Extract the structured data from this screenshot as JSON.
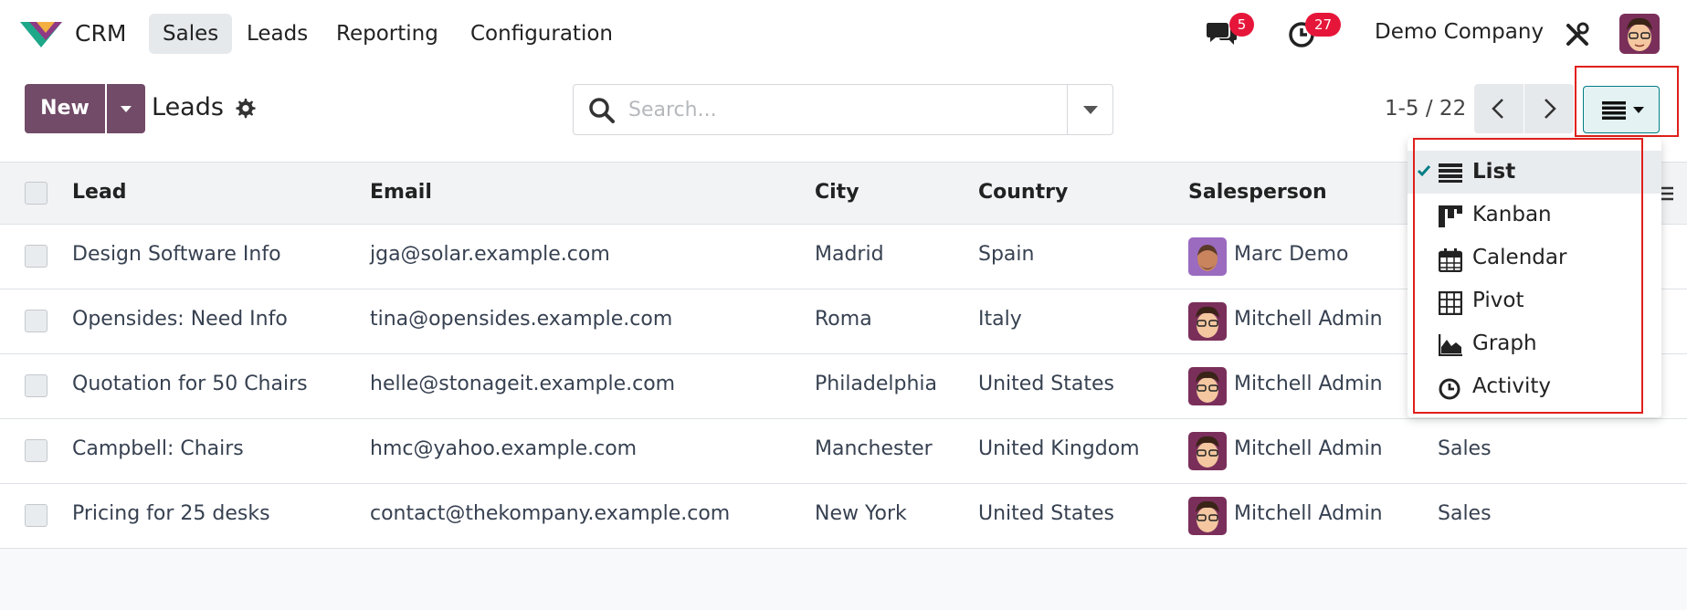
{
  "navbar": {
    "app_name": "CRM",
    "menu": [
      "Sales",
      "Leads",
      "Reporting",
      "Configuration"
    ],
    "active_menu": "Sales",
    "messages_badge": "5",
    "activities_badge": "27",
    "company": "Demo Company"
  },
  "control": {
    "new_label": "New",
    "title": "Leads",
    "search_placeholder": "Search...",
    "pager": "1-5 / 22"
  },
  "table": {
    "headers": [
      "Lead",
      "Email",
      "City",
      "Country",
      "Salesperson"
    ],
    "rows": [
      {
        "lead": "Design Software Info",
        "email": "jga@solar.example.com",
        "city": "Madrid",
        "country": "Spain",
        "salesperson": "Marc Demo",
        "team": ""
      },
      {
        "lead": "Opensides: Need Info",
        "email": "tina@opensides.example.com",
        "city": "Roma",
        "country": "Italy",
        "salesperson": "Mitchell Admin",
        "team": ""
      },
      {
        "lead": "Quotation for 50 Chairs",
        "email": "helle@stonageit.example.com",
        "city": "Philadelphia",
        "country": "United States",
        "salesperson": "Mitchell Admin",
        "team": ""
      },
      {
        "lead": "Campbell: Chairs",
        "email": "hmc@yahoo.example.com",
        "city": "Manchester",
        "country": "United Kingdom",
        "salesperson": "Mitchell Admin",
        "team": "Sales"
      },
      {
        "lead": "Pricing for 25 desks",
        "email": "contact@thekompany.example.com",
        "city": "New York",
        "country": "United States",
        "salesperson": "Mitchell Admin",
        "team": "Sales"
      }
    ]
  },
  "view_menu": {
    "items": [
      "List",
      "Kanban",
      "Calendar",
      "Pivot",
      "Graph",
      "Activity"
    ],
    "selected": "List"
  },
  "colors": {
    "brand": "#714b67",
    "accent": "#017e84",
    "badge": "#e6163a",
    "highlight": "#e0201b"
  }
}
